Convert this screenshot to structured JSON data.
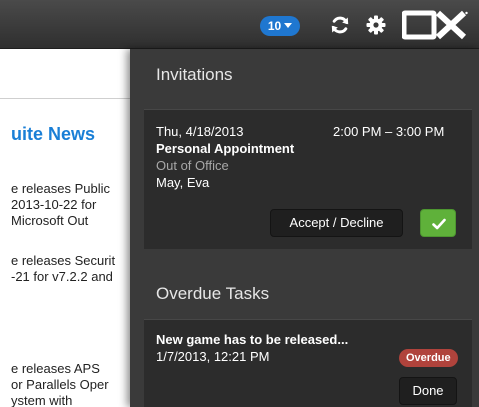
{
  "topbar": {
    "notification_count": "10",
    "refresh_icon": "refresh-icon",
    "settings_icon": "gear-icon",
    "logo_text": "OX"
  },
  "background_news": {
    "title": "uite News",
    "lines": [
      "e releases Public",
      " 2013-10-22 for",
      "Microsoft Out",
      "e releases Securit",
      "-21 for v7.2.2 and",
      "e releases APS",
      "or Parallels Oper",
      "ystem with"
    ]
  },
  "invitations": {
    "title": "Invitations",
    "item": {
      "date": "Thu, 4/18/2013",
      "time": "2:00 PM – 3:00 PM",
      "subject": "Personal Appointment",
      "shown_as": "Out of Office",
      "organizer": "May, Eva",
      "accept_decline_label": "Accept / Decline"
    }
  },
  "overdue_tasks": {
    "title": "Overdue Tasks",
    "item": {
      "title": "New game has to be released...",
      "due": "1/7/2013, 12:21 PM",
      "status": "Overdue",
      "done_label": "Done"
    }
  },
  "colors": {
    "badge_blue": "#1f77d0",
    "news_blue": "#1a7fd6",
    "panel_bg": "#3a3a3a",
    "card_bg": "#2c2c2c",
    "accept_green": "#5fb13a",
    "overdue_red": "#b0433c"
  }
}
